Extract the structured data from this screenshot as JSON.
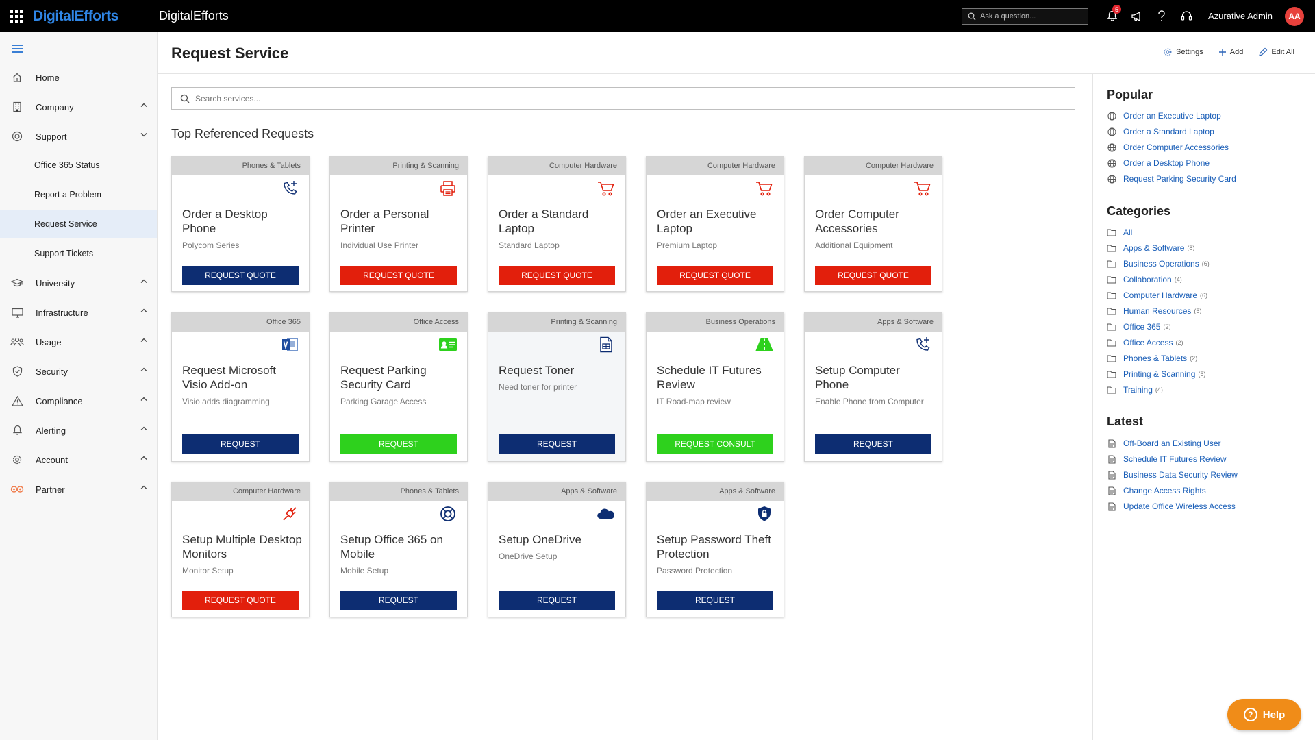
{
  "topbar": {
    "logo": "DigitalEfforts",
    "app_name": "DigitalEfforts",
    "search_placeholder": "Ask a question...",
    "notification_count": "5",
    "user_name": "Azurative Admin",
    "user_initials": "AA"
  },
  "sidebar": {
    "items": [
      {
        "label": "Home",
        "icon": "home-icon"
      },
      {
        "label": "Company",
        "icon": "building-icon"
      },
      {
        "label": "Support",
        "icon": "support-icon"
      },
      {
        "label": "University",
        "icon": "graduation-cap-icon"
      },
      {
        "label": "Infrastructure",
        "icon": "monitor-icon"
      },
      {
        "label": "Usage",
        "icon": "users-icon"
      },
      {
        "label": "Security",
        "icon": "shield-icon"
      },
      {
        "label": "Compliance",
        "icon": "warning-icon"
      },
      {
        "label": "Alerting",
        "icon": "bell-icon"
      },
      {
        "label": "Account",
        "icon": "gear-icon"
      },
      {
        "label": "Partner",
        "icon": "partner-icon"
      }
    ],
    "support_children": [
      "Office 365 Status",
      "Report a Problem",
      "Request Service",
      "Support Tickets"
    ]
  },
  "header": {
    "title": "Request Service",
    "settings_label": "Settings",
    "add_label": "Add",
    "edit_all_label": "Edit All"
  },
  "main": {
    "search_placeholder": "Search services...",
    "section_title": "Top Referenced Requests",
    "cards": [
      {
        "category": "Phones & Tablets",
        "title": "Order a Desktop Phone",
        "subtitle": "Polycom Series",
        "button": "REQUEST QUOTE",
        "icon": "phone-add-icon"
      },
      {
        "category": "Printing & Scanning",
        "title": "Order a Personal Printer",
        "subtitle": "Individual Use Printer",
        "button": "REQUEST QUOTE",
        "icon": "printer-icon"
      },
      {
        "category": "Computer Hardware",
        "title": "Order a Standard Laptop",
        "subtitle": "Standard Laptop",
        "button": "REQUEST QUOTE",
        "icon": "cart-icon"
      },
      {
        "category": "Computer Hardware",
        "title": "Order an Executive Laptop",
        "subtitle": "Premium Laptop",
        "button": "REQUEST QUOTE",
        "icon": "cart-icon"
      },
      {
        "category": "Computer Hardware",
        "title": "Order Computer Accessories",
        "subtitle": "Additional Equipment",
        "button": "REQUEST QUOTE",
        "icon": "cart-icon"
      },
      {
        "category": "Office 365",
        "title": "Request Microsoft Visio Add-on",
        "subtitle": "Visio adds diagramming",
        "button": "REQUEST",
        "icon": "visio-icon"
      },
      {
        "category": "Office Access",
        "title": "Request Parking Security Card",
        "subtitle": "Parking Garage Access",
        "button": "REQUEST",
        "icon": "id-card-icon"
      },
      {
        "category": "Printing & Scanning",
        "title": "Request Toner",
        "subtitle": "Need toner for printer",
        "button": "REQUEST",
        "icon": "document-icon"
      },
      {
        "category": "Business Operations",
        "title": "Schedule IT Futures Review",
        "subtitle": "IT Road-map review",
        "button": "REQUEST CONSULT",
        "icon": "road-icon"
      },
      {
        "category": "Apps & Software",
        "title": "Setup Computer Phone",
        "subtitle": "Enable Phone from Computer",
        "button": "REQUEST",
        "icon": "phone-add-icon"
      },
      {
        "category": "Computer Hardware",
        "title": "Setup Multiple Desktop Monitors",
        "subtitle": "Monitor Setup",
        "button": "REQUEST QUOTE",
        "icon": "plug-icon"
      },
      {
        "category": "Phones & Tablets",
        "title": "Setup Office 365 on Mobile",
        "subtitle": "Mobile Setup",
        "button": "REQUEST",
        "icon": "lifebuoy-icon"
      },
      {
        "category": "Apps & Software",
        "title": "Setup OneDrive",
        "subtitle": "OneDrive Setup",
        "button": "REQUEST",
        "icon": "cloud-icon"
      },
      {
        "category": "Apps & Software",
        "title": "Setup Password Theft Protection",
        "subtitle": "Password Protection",
        "button": "REQUEST",
        "icon": "shield-lock-icon"
      }
    ]
  },
  "right_panel": {
    "popular_title": "Popular",
    "popular": [
      "Order an Executive Laptop",
      "Order a Standard Laptop",
      "Order Computer Accessories",
      "Order a Desktop Phone",
      "Request Parking Security Card"
    ],
    "categories_title": "Categories",
    "categories": [
      {
        "label": "All",
        "count": ""
      },
      {
        "label": "Apps & Software",
        "count": "(8)"
      },
      {
        "label": "Business Operations",
        "count": "(6)"
      },
      {
        "label": "Collaboration",
        "count": "(4)"
      },
      {
        "label": "Computer Hardware",
        "count": "(6)"
      },
      {
        "label": "Human Resources",
        "count": "(5)"
      },
      {
        "label": "Office 365",
        "count": "(2)"
      },
      {
        "label": "Office Access",
        "count": "(2)"
      },
      {
        "label": "Phones & Tablets",
        "count": "(2)"
      },
      {
        "label": "Printing & Scanning",
        "count": "(5)"
      },
      {
        "label": "Training",
        "count": "(4)"
      }
    ],
    "latest_title": "Latest",
    "latest": [
      "Off-Board an Existing User",
      "Schedule IT Futures Review",
      "Business Data Security Review",
      "Change Access Rights",
      "Update Office Wireless Access"
    ]
  },
  "help": {
    "label": "Help"
  },
  "colors": {
    "brand_blue": "#2f86e6",
    "button_red": "#e21f0c",
    "button_navy": "#0d2d72",
    "button_green": "#2ed11d",
    "link_blue": "#1b5fb8",
    "help_orange": "#f08c18"
  }
}
